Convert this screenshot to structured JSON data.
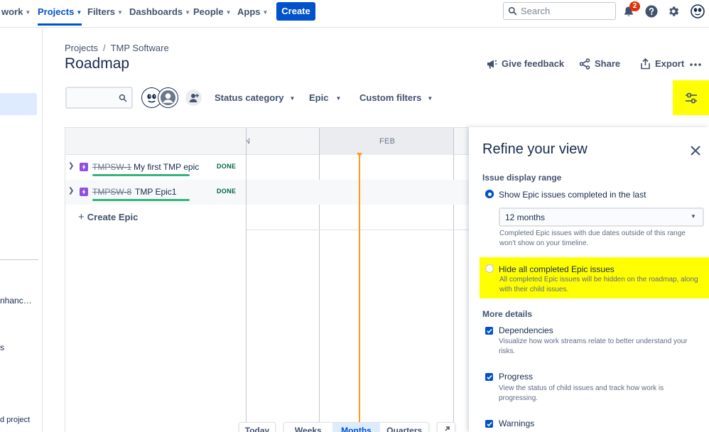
{
  "topnav": {
    "items": [
      {
        "label": "work",
        "chevron": true
      },
      {
        "label": "Projects",
        "chevron": true,
        "active": true
      },
      {
        "label": "Filters",
        "chevron": true
      },
      {
        "label": "Dashboards",
        "chevron": true
      },
      {
        "label": "People",
        "chevron": true
      },
      {
        "label": "Apps",
        "chevron": true
      }
    ],
    "create_label": "Create",
    "search_placeholder": "Search",
    "notification_count": "2",
    "accent": "#0052CC"
  },
  "sidebar": {
    "truncated_items": [
      "nhanc…",
      "s",
      "d project"
    ]
  },
  "breadcrumb": {
    "items": [
      "Projects",
      "TMP Software"
    ],
    "separator": "/"
  },
  "page": {
    "title": "Roadmap",
    "actions": {
      "feedback": "Give feedback",
      "share": "Share",
      "export": "Export"
    }
  },
  "filters": {
    "status_category": "Status category",
    "epic": "Epic",
    "custom_filters": "Custom filters"
  },
  "timeline": {
    "months": [
      "N",
      "FEB"
    ],
    "epics": [
      {
        "key": "TMPSW-1",
        "summary": "My first TMP epic",
        "status": "DONE",
        "progress": 1.0
      },
      {
        "key": "TMPSW-8",
        "summary": "TMP Epic1",
        "status": "DONE",
        "progress": 1.0
      }
    ],
    "create_epic_label": "Create Epic",
    "controls": {
      "today": "Today",
      "scales": [
        "Weeks",
        "Months",
        "Quarters"
      ],
      "selected_scale": "Months"
    }
  },
  "refine": {
    "title": "Refine your view",
    "issue_range": {
      "title": "Issue display range",
      "option_show": "Show Epic issues completed in the last",
      "select_value": "12 months",
      "show_desc": "Completed Epic issues with due dates outside of this range won't show on your timeline.",
      "option_hide": "Hide all completed Epic issues",
      "hide_desc": "All completed Epic issues will be hidden on the roadmap, along with their child issues."
    },
    "more": {
      "title": "More details",
      "items": [
        {
          "label": "Dependencies",
          "desc": "Visualize how work streams relate to better understand your risks.",
          "checked": true
        },
        {
          "label": "Progress",
          "desc": "View the status of child issues and track how work is progressing.",
          "checked": true
        },
        {
          "label": "Warnings",
          "desc": "",
          "checked": true
        }
      ]
    }
  }
}
